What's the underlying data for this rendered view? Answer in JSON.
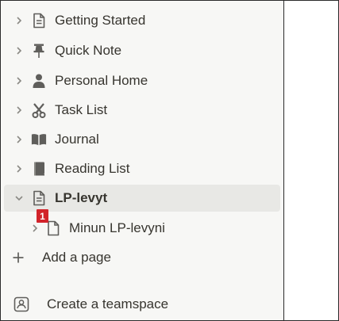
{
  "sidebar": {
    "items": [
      {
        "label": "Getting Started",
        "icon": "document-icon"
      },
      {
        "label": "Quick Note",
        "icon": "pin-icon"
      },
      {
        "label": "Personal Home",
        "icon": "person-icon"
      },
      {
        "label": "Task List",
        "icon": "scissors-icon"
      },
      {
        "label": "Journal",
        "icon": "open-book-icon"
      },
      {
        "label": "Reading List",
        "icon": "book-icon"
      },
      {
        "label": "LP-levyt",
        "icon": "document-icon",
        "expanded": true,
        "selected": true
      },
      {
        "label": "Minun LP-levyni",
        "icon": "blank-page-icon",
        "child": true
      }
    ],
    "add_page_label": "Add a page",
    "create_teamspace_label": "Create a teamspace",
    "badge": "1"
  },
  "colors": {
    "text": "#37352f",
    "icon": "#5f5e5b",
    "sidebar_bg": "#f7f7f5",
    "selected_bg": "#e8e8e5",
    "badge_bg": "#d2232a"
  }
}
